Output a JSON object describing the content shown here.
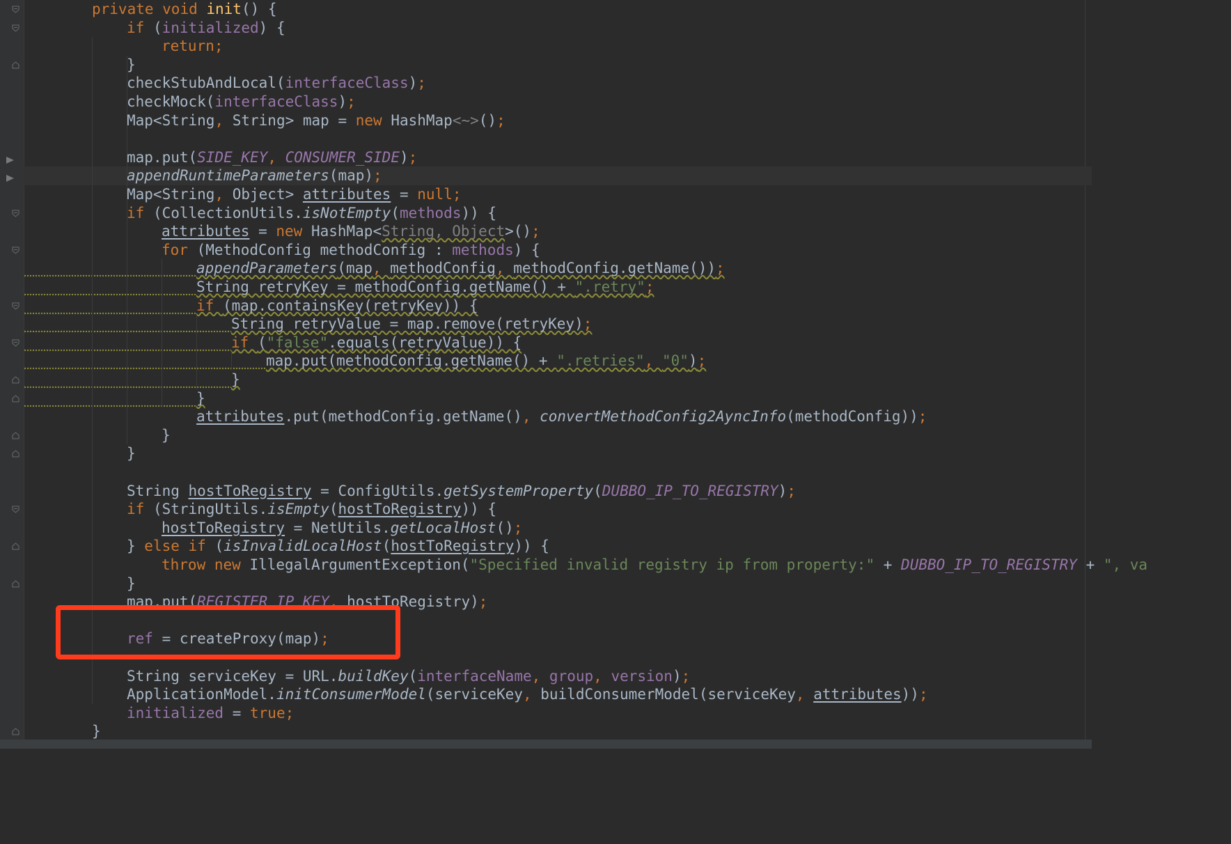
{
  "colors": {
    "background": "#2b2b2b",
    "gutter": "#313335",
    "keyword": "#cc7832",
    "field": "#9876aa",
    "string": "#6a8759",
    "plain": "#a9b7c6",
    "annotation_box": "#ff3b1e"
  },
  "code_lines": [
    {
      "indent": 1,
      "tokens": [
        [
          "kw",
          "private "
        ],
        [
          "kw",
          "void "
        ],
        [
          "fn",
          "init"
        ],
        [
          "p",
          "() {"
        ]
      ]
    },
    {
      "indent": 2,
      "tokens": [
        [
          "kw",
          "if "
        ],
        [
          "p",
          "("
        ],
        [
          "fld",
          "initialized"
        ],
        [
          "p",
          ") {"
        ]
      ]
    },
    {
      "indent": 3,
      "tokens": [
        [
          "kw",
          "return;"
        ]
      ]
    },
    {
      "indent": 2,
      "tokens": [
        [
          "p",
          "}"
        ]
      ]
    },
    {
      "indent": 2,
      "tokens": [
        [
          "p",
          "checkStubAndLocal("
        ],
        [
          "fld",
          "interfaceClass"
        ],
        [
          "p",
          ")"
        ],
        [
          "kw",
          ";"
        ]
      ]
    },
    {
      "indent": 2,
      "tokens": [
        [
          "p",
          "checkMock("
        ],
        [
          "fld",
          "interfaceClass"
        ],
        [
          "p",
          ")"
        ],
        [
          "kw",
          ";"
        ]
      ]
    },
    {
      "indent": 2,
      "tokens": [
        [
          "p",
          "Map<String"
        ],
        [
          "kw",
          ", "
        ],
        [
          "p",
          "String> map = "
        ],
        [
          "kw",
          "new "
        ],
        [
          "p",
          "HashMap"
        ],
        [
          "dim",
          "<~>"
        ],
        [
          "p",
          "()"
        ],
        [
          "kw",
          ";"
        ]
      ]
    },
    {
      "indent": 0,
      "tokens": []
    },
    {
      "indent": 2,
      "tokens": [
        [
          "p",
          "map.put("
        ],
        [
          "cst",
          "SIDE_KEY"
        ],
        [
          "kw",
          ", "
        ],
        [
          "cst",
          "CONSUMER_SIDE"
        ],
        [
          "p",
          ")"
        ],
        [
          "kw",
          ";"
        ]
      ]
    },
    {
      "indent": 2,
      "highlight": true,
      "tokens": [
        [
          "st",
          "appendRuntimeParameters"
        ],
        [
          "p",
          "(map)"
        ],
        [
          "kw",
          ";"
        ]
      ]
    },
    {
      "indent": 2,
      "tokens": [
        [
          "p",
          "Map<String"
        ],
        [
          "kw",
          ", "
        ],
        [
          "p",
          "Object> "
        ],
        [
          "ul",
          "attributes"
        ],
        [
          "p",
          " = "
        ],
        [
          "kw",
          "null;"
        ]
      ]
    },
    {
      "indent": 2,
      "tokens": [
        [
          "kw",
          "if "
        ],
        [
          "p",
          "(CollectionUtils."
        ],
        [
          "st",
          "isNotEmpty"
        ],
        [
          "p",
          "("
        ],
        [
          "fld",
          "methods"
        ],
        [
          "p",
          ")) {"
        ]
      ]
    },
    {
      "indent": 3,
      "tokens": [
        [
          "ul",
          "attributes"
        ],
        [
          "p",
          " = "
        ],
        [
          "kw",
          "new "
        ],
        [
          "p",
          "HashMap<"
        ],
        [
          "wdim",
          "String, Object"
        ],
        [
          "p",
          ">()"
        ],
        [
          "kw",
          ";"
        ]
      ]
    },
    {
      "indent": 3,
      "tokens": [
        [
          "kw",
          "for "
        ],
        [
          "p",
          "(MethodConfig methodConfig : "
        ],
        [
          "fld",
          "methods"
        ],
        [
          "p",
          ") {"
        ]
      ]
    },
    {
      "indent": 4,
      "warn": true,
      "tokens": [
        [
          "st",
          "appendParameters"
        ],
        [
          "p",
          "(map"
        ],
        [
          "kw",
          ", "
        ],
        [
          "p",
          "methodConfig"
        ],
        [
          "kw",
          ", "
        ],
        [
          "p",
          "methodConfig.getName())"
        ],
        [
          "kw",
          ";"
        ]
      ]
    },
    {
      "indent": 4,
      "warn": true,
      "tokens": [
        [
          "p",
          "String retryKey = methodConfig.getName() + "
        ],
        [
          "str",
          "\".retry\""
        ],
        [
          "kw",
          ";"
        ]
      ]
    },
    {
      "indent": 4,
      "warn": true,
      "tokens": [
        [
          "kw",
          "if "
        ],
        [
          "p",
          "(map.containsKey(retryKey)) {"
        ]
      ]
    },
    {
      "indent": 5,
      "warn": true,
      "tokens": [
        [
          "p",
          "String retryValue = map.remove(retryKey)"
        ],
        [
          "kw",
          ";"
        ]
      ]
    },
    {
      "indent": 5,
      "warn": true,
      "tokens": [
        [
          "kw",
          "if "
        ],
        [
          "p",
          "("
        ],
        [
          "str",
          "\"false\""
        ],
        [
          "p",
          ".equals(retryValue)) {"
        ]
      ]
    },
    {
      "indent": 6,
      "warn": true,
      "tokens": [
        [
          "p",
          "map.put(methodConfig.getName() + "
        ],
        [
          "str",
          "\".retries\""
        ],
        [
          "kw",
          ", "
        ],
        [
          "str",
          "\"0\""
        ],
        [
          "p",
          ")"
        ],
        [
          "kw",
          ";"
        ]
      ]
    },
    {
      "indent": 5,
      "warn": true,
      "tokens": [
        [
          "p",
          "}"
        ]
      ]
    },
    {
      "indent": 4,
      "warn": true,
      "tokens": [
        [
          "p",
          "}"
        ]
      ]
    },
    {
      "indent": 4,
      "tokens": [
        [
          "ul",
          "attributes"
        ],
        [
          "p",
          ".put(methodConfig.getName()"
        ],
        [
          "kw",
          ", "
        ],
        [
          "st",
          "convertMethodConfig2AyncInfo"
        ],
        [
          "p",
          "(methodConfig))"
        ],
        [
          "kw",
          ";"
        ]
      ]
    },
    {
      "indent": 3,
      "tokens": [
        [
          "p",
          "}"
        ]
      ]
    },
    {
      "indent": 2,
      "tokens": [
        [
          "p",
          "}"
        ]
      ]
    },
    {
      "indent": 0,
      "tokens": []
    },
    {
      "indent": 2,
      "tokens": [
        [
          "p",
          "String "
        ],
        [
          "ul",
          "hostToRegistry"
        ],
        [
          "p",
          " = ConfigUtils."
        ],
        [
          "st",
          "getSystemProperty"
        ],
        [
          "p",
          "("
        ],
        [
          "cst",
          "DUBBO_IP_TO_REGISTRY"
        ],
        [
          "p",
          ")"
        ],
        [
          "kw",
          ";"
        ]
      ]
    },
    {
      "indent": 2,
      "tokens": [
        [
          "kw",
          "if "
        ],
        [
          "p",
          "(StringUtils."
        ],
        [
          "st",
          "isEmpty"
        ],
        [
          "p",
          "("
        ],
        [
          "ul",
          "hostToRegistry"
        ],
        [
          "p",
          ")) {"
        ]
      ]
    },
    {
      "indent": 3,
      "tokens": [
        [
          "ul",
          "hostToRegistry"
        ],
        [
          "p",
          " = NetUtils."
        ],
        [
          "st",
          "getLocalHost"
        ],
        [
          "p",
          "()"
        ],
        [
          "kw",
          ";"
        ]
      ]
    },
    {
      "indent": 2,
      "tokens": [
        [
          "p",
          "} "
        ],
        [
          "kw",
          "else if "
        ],
        [
          "p",
          "("
        ],
        [
          "st",
          "isInvalidLocalHost"
        ],
        [
          "p",
          "("
        ],
        [
          "ul",
          "hostToRegistry"
        ],
        [
          "p",
          ")) {"
        ]
      ]
    },
    {
      "indent": 3,
      "tokens": [
        [
          "kw",
          "throw new "
        ],
        [
          "p",
          "IllegalArgumentException("
        ],
        [
          "str",
          "\"Specified invalid registry ip from property:\""
        ],
        [
          "p",
          " + "
        ],
        [
          "cst",
          "DUBBO_IP_TO_REGISTRY"
        ],
        [
          "p",
          " + "
        ],
        [
          "str",
          "\", va"
        ]
      ]
    },
    {
      "indent": 2,
      "tokens": [
        [
          "p",
          "}"
        ]
      ]
    },
    {
      "indent": 2,
      "tokens": [
        [
          "p",
          "map.put("
        ],
        [
          "cst",
          "REGISTER_IP_KEY"
        ],
        [
          "kw",
          ", "
        ],
        [
          "p",
          "hostToRegistry)"
        ],
        [
          "kw",
          ";"
        ]
      ]
    },
    {
      "indent": 0,
      "tokens": []
    },
    {
      "indent": 2,
      "tokens": [
        [
          "fld",
          "ref"
        ],
        [
          "p",
          " = createProxy(map)"
        ],
        [
          "kw",
          ";"
        ]
      ]
    },
    {
      "indent": 0,
      "tokens": []
    },
    {
      "indent": 2,
      "tokens": [
        [
          "p",
          "String serviceKey = URL."
        ],
        [
          "st",
          "buildKey"
        ],
        [
          "p",
          "("
        ],
        [
          "fld",
          "interfaceName"
        ],
        [
          "kw",
          ", "
        ],
        [
          "fld",
          "group"
        ],
        [
          "kw",
          ", "
        ],
        [
          "fld",
          "version"
        ],
        [
          "p",
          ")"
        ],
        [
          "kw",
          ";"
        ]
      ]
    },
    {
      "indent": 2,
      "tokens": [
        [
          "p",
          "ApplicationModel."
        ],
        [
          "st",
          "initConsumerModel"
        ],
        [
          "p",
          "(serviceKey"
        ],
        [
          "kw",
          ", "
        ],
        [
          "p",
          "buildConsumerModel(serviceKey"
        ],
        [
          "kw",
          ", "
        ],
        [
          "ul",
          "attributes"
        ],
        [
          "p",
          "))"
        ],
        [
          "kw",
          ";"
        ]
      ]
    },
    {
      "indent": 2,
      "tokens": [
        [
          "fld",
          "initialized"
        ],
        [
          "p",
          " = "
        ],
        [
          "kw",
          "true;"
        ]
      ]
    },
    {
      "indent": 1,
      "tokens": [
        [
          "p",
          "}"
        ]
      ]
    }
  ],
  "gutter": {
    "fold_marker_lines": [
      0,
      1,
      3,
      11,
      13,
      16,
      18,
      20,
      21,
      23,
      24,
      27,
      29,
      31,
      39
    ],
    "fold_open_lines": [
      0,
      1,
      11,
      13,
      16,
      18,
      27
    ],
    "run_marker_lines": [
      8,
      9
    ]
  },
  "annotation": {
    "label": "highlight-box",
    "target_line": 34
  }
}
